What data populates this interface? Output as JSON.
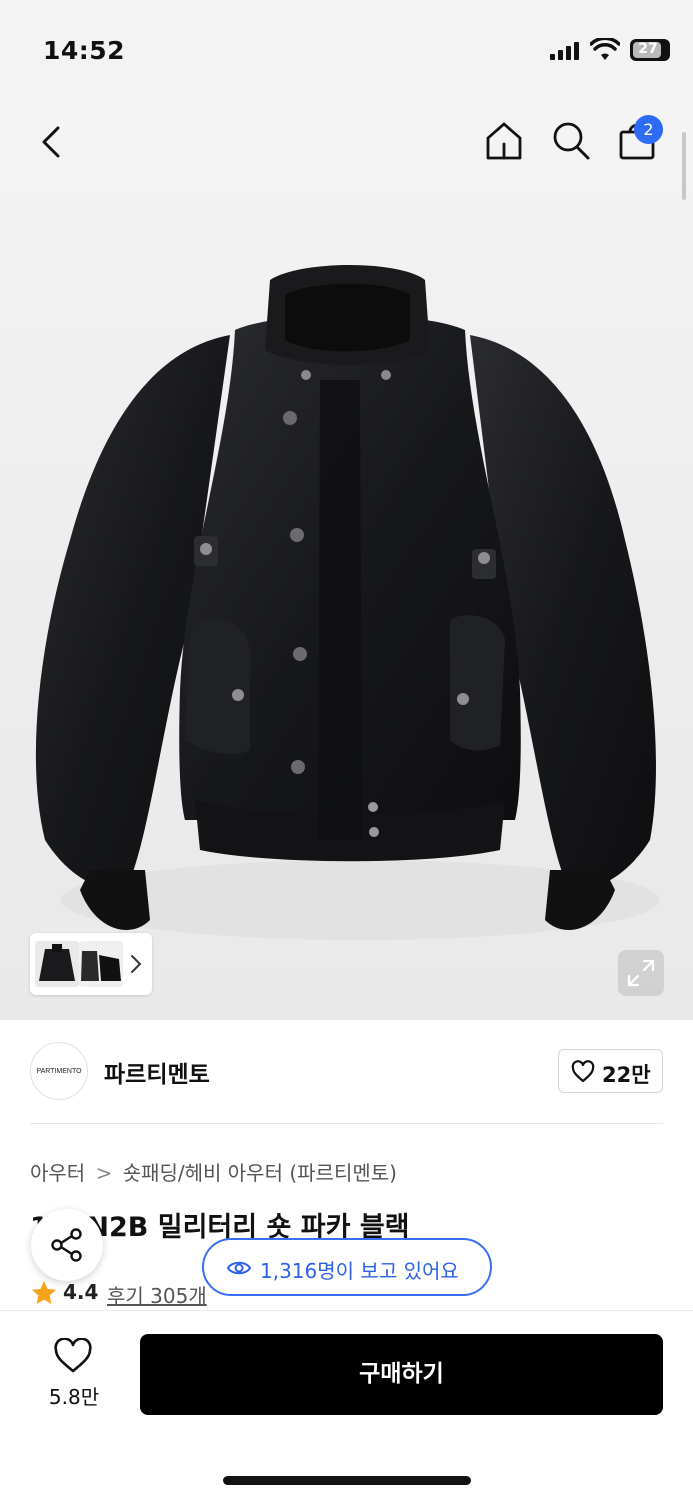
{
  "status_bar": {
    "time": "14:52",
    "battery": "27"
  },
  "header": {
    "cart_count": "2"
  },
  "gallery": {
    "total_thumbs_visible": 2
  },
  "brand": {
    "logo_text": "PARTIMENTO",
    "name": "파르티멘토",
    "likes": "22만"
  },
  "breadcrumb": {
    "category": "아우터",
    "subcategory": "숏패딩/헤비 아우터",
    "brand": "(파르티멘토)"
  },
  "product": {
    "title": "1 0 N2B 밀리터리 숏 파카 블랙"
  },
  "rating": {
    "score": "4.4",
    "reviews": "후기 305개"
  },
  "viewers": {
    "text": "1,316명이 보고 있어요"
  },
  "footer": {
    "wish_count": "5.8만",
    "buy_label": "구매하기"
  },
  "colors": {
    "accent": "#2f6cf5",
    "buy_button": "#000000",
    "star": "#f7a21b"
  }
}
